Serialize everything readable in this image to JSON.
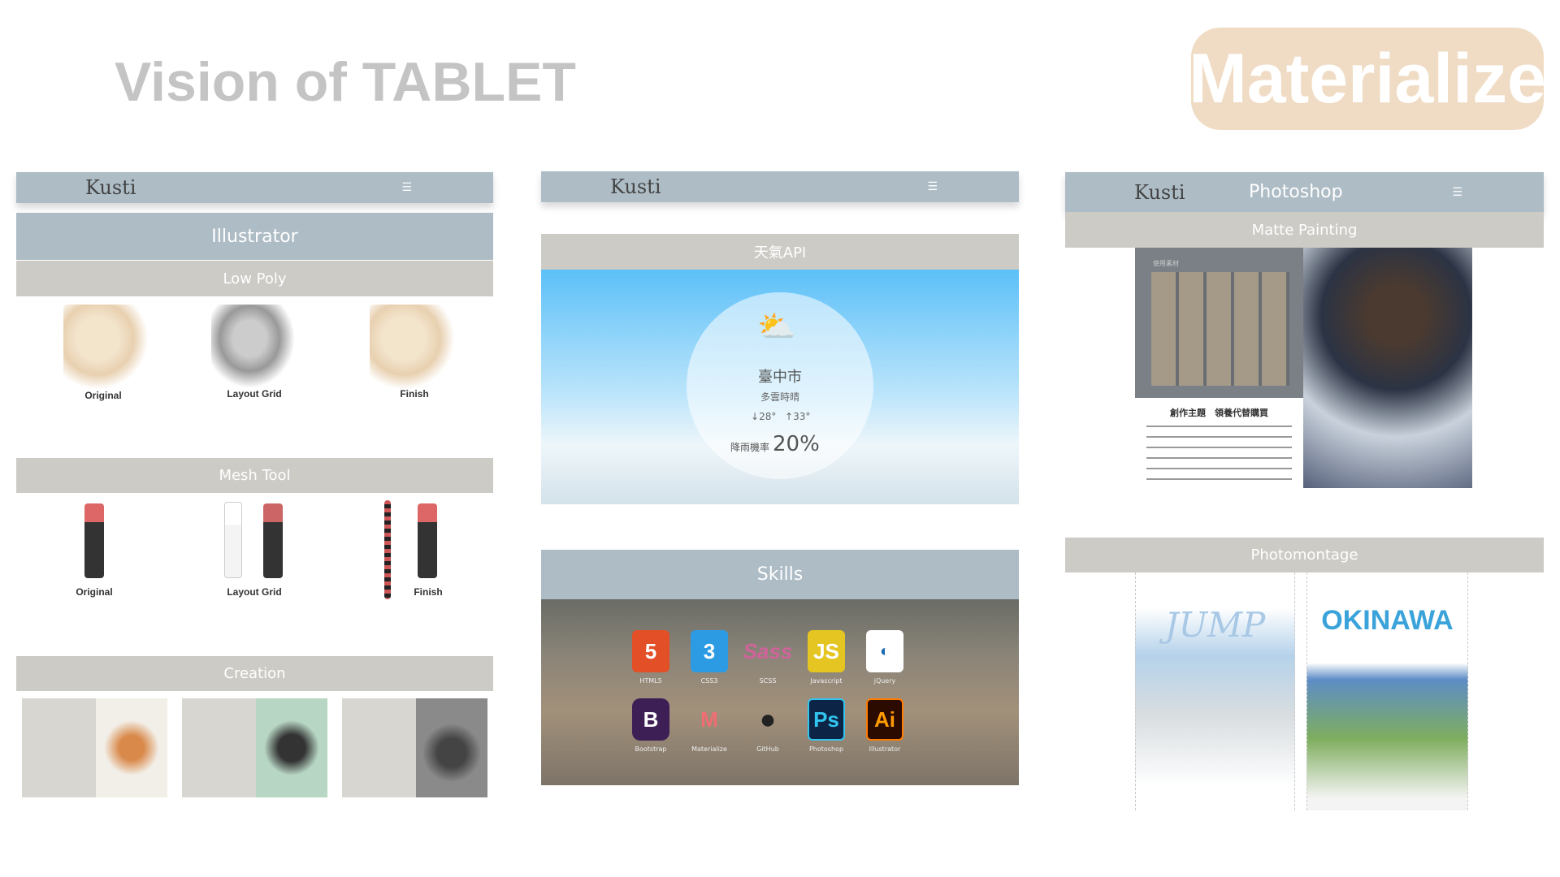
{
  "header": {
    "title": "Vision of TABLET",
    "badge": "Materialize",
    "badge_color": "#f0dcc4"
  },
  "brand": "Kusti",
  "menu_icon": "hamburger-icon",
  "col1": {
    "section": "Illustrator",
    "low_poly": {
      "title": "Low Poly",
      "captions": [
        "Original",
        "Layout Grid",
        "Finish"
      ]
    },
    "mesh": {
      "title": "Mesh Tool",
      "captions": [
        "Original",
        "Layout Grid",
        "Finish"
      ]
    },
    "creation": {
      "title": "Creation"
    }
  },
  "col2": {
    "weather": {
      "title": "天氣API",
      "city": "臺中市",
      "condition": "多雲時晴",
      "low": "28°",
      "high": "33°",
      "rain_label": "降雨機率",
      "rain_value": "20%"
    },
    "skills": {
      "title": "Skills",
      "items": [
        "HTML5",
        "CSS3",
        "SCSS",
        "Javascript",
        "jQuery",
        "Bootstrap",
        "Materialize",
        "GitHub",
        "Photoshop",
        "Illustrator"
      ]
    }
  },
  "col3": {
    "nav_title": "Photoshop",
    "matte": {
      "title": "Matte Painting",
      "materials": "使用素材",
      "theme": "創作主題　領養代替購買"
    },
    "montage": {
      "title": "Photomontage",
      "left": "JUMP",
      "right": "OKINAWA"
    }
  }
}
